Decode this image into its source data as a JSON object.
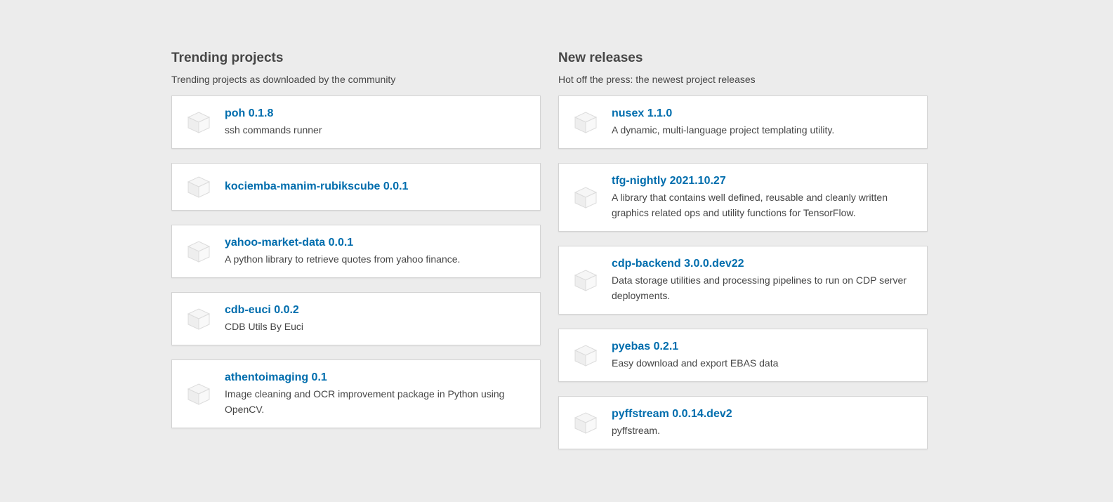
{
  "trending": {
    "title": "Trending projects",
    "subtitle": "Trending projects as downloaded by the community",
    "items": [
      {
        "name": "poh 0.1.8",
        "desc": "ssh commands runner"
      },
      {
        "name": "kociemba-manim-rubikscube 0.0.1",
        "desc": ""
      },
      {
        "name": "yahoo-market-data 0.0.1",
        "desc": "A python library to retrieve quotes from yahoo finance."
      },
      {
        "name": "cdb-euci 0.0.2",
        "desc": "CDB Utils By Euci"
      },
      {
        "name": "athentoimaging 0.1",
        "desc": "Image cleaning and OCR improvement package in Python using OpenCV."
      }
    ]
  },
  "releases": {
    "title": "New releases",
    "subtitle": "Hot off the press: the newest project releases",
    "items": [
      {
        "name": "nusex 1.1.0",
        "desc": "A dynamic, multi-language project templating utility."
      },
      {
        "name": "tfg-nightly 2021.10.27",
        "desc": "A library that contains well defined, reusable and cleanly written graphics related ops and utility functions for TensorFlow."
      },
      {
        "name": "cdp-backend 3.0.0.dev22",
        "desc": "Data storage utilities and processing pipelines to run on CDP server deployments."
      },
      {
        "name": "pyebas 0.2.1",
        "desc": "Easy download and export EBAS data"
      },
      {
        "name": "pyffstream 0.0.14.dev2",
        "desc": "pyffstream."
      }
    ]
  },
  "icon": "package-box-icon",
  "colors": {
    "background": "#ececec",
    "link": "#006dad",
    "text": "#464646"
  }
}
